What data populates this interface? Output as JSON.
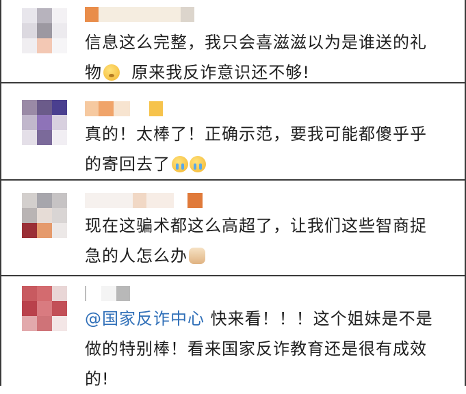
{
  "comments": [
    {
      "lines": [
        "信息这么完整，我只会喜滋滋以为是谁送的礼",
        "物",
        "原来我反诈意识还不够!"
      ],
      "emojis": [
        "dizzy-face-emoji"
      ]
    },
    {
      "lines": [
        "真的！太棒了！正确示范，要我可能都傻乎乎",
        "的寄回去了"
      ],
      "emojis": [
        "crying-face-emoji",
        "crying-face-emoji"
      ]
    },
    {
      "lines": [
        "现在这骗术都这么高超了，让我们这些智商捉",
        "急的人怎么办"
      ],
      "emojis": [
        "cat-face-emoji"
      ]
    },
    {
      "mention": "@国家反诈中心",
      "lines": [
        " 快来看！！！这个姐妹是不是",
        "做的特别棒！看来国家反诈教育还是很有成效",
        "的!"
      ]
    }
  ],
  "colors": {
    "border": "#3a3a3a",
    "text": "#1f1f1f",
    "mention": "#2f6fb8"
  }
}
